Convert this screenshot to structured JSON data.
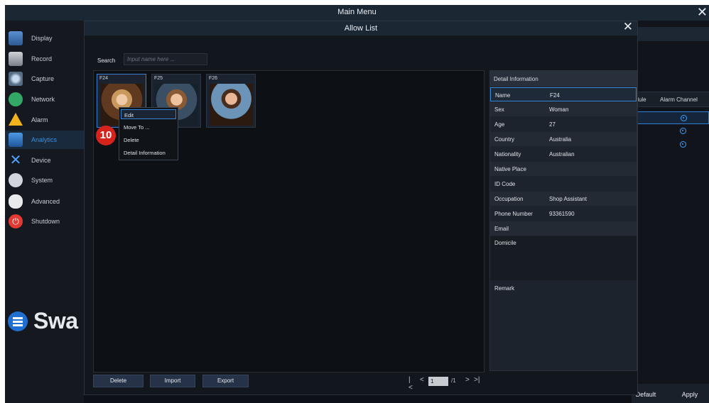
{
  "window": {
    "title": "Main Menu",
    "close_glyph": "✕"
  },
  "sidebar": {
    "items": [
      {
        "label": "Display",
        "icon": "display-icon"
      },
      {
        "label": "Record",
        "icon": "record-icon"
      },
      {
        "label": "Capture",
        "icon": "capture-icon"
      },
      {
        "label": "Network",
        "icon": "network-icon"
      },
      {
        "label": "Alarm",
        "icon": "alarm-icon"
      },
      {
        "label": "Analytics",
        "icon": "analytics-icon",
        "active": true
      },
      {
        "label": "Device",
        "icon": "device-icon"
      },
      {
        "label": "System",
        "icon": "system-icon"
      },
      {
        "label": "Advanced",
        "icon": "advanced-icon"
      },
      {
        "label": "Shutdown",
        "icon": "shutdown-icon"
      }
    ],
    "logo_text": "Swa"
  },
  "background_window": {
    "columns": [
      "edule",
      "Alarm Channel"
    ],
    "buttons": {
      "default": "Default",
      "apply": "Apply"
    }
  },
  "modal": {
    "title": "Allow List",
    "close_glyph": "✕",
    "search": {
      "label": "Search",
      "placeholder": "Input name here ..."
    },
    "faces": [
      {
        "id": "F24",
        "selected": true
      },
      {
        "id": "F25"
      },
      {
        "id": "F26"
      }
    ],
    "context_menu": [
      "Edit",
      "Move To ...",
      "Delete",
      "Detail Information"
    ],
    "step_badge": "10",
    "detail": {
      "title": "Detail Information",
      "fields": [
        {
          "key": "Name",
          "value": "F24"
        },
        {
          "key": "Sex",
          "value": "Woman"
        },
        {
          "key": "Age",
          "value": "27"
        },
        {
          "key": "Country",
          "value": "Australia"
        },
        {
          "key": "Nationality",
          "value": "Australian"
        },
        {
          "key": "Native Place",
          "value": ""
        },
        {
          "key": "ID Code",
          "value": ""
        },
        {
          "key": "Occupation",
          "value": "Shop Assistant"
        },
        {
          "key": "Phone Number",
          "value": "93361590"
        },
        {
          "key": "Email",
          "value": ""
        }
      ],
      "domicile_label": "Domicile",
      "remark_label": "Remark"
    },
    "buttons": {
      "delete": "Delete",
      "import": "Import",
      "export": "Export"
    },
    "pager": {
      "first": "|<",
      "prev": "<",
      "page": "1",
      "total": "/1",
      "next": ">",
      "last": ">|"
    }
  }
}
